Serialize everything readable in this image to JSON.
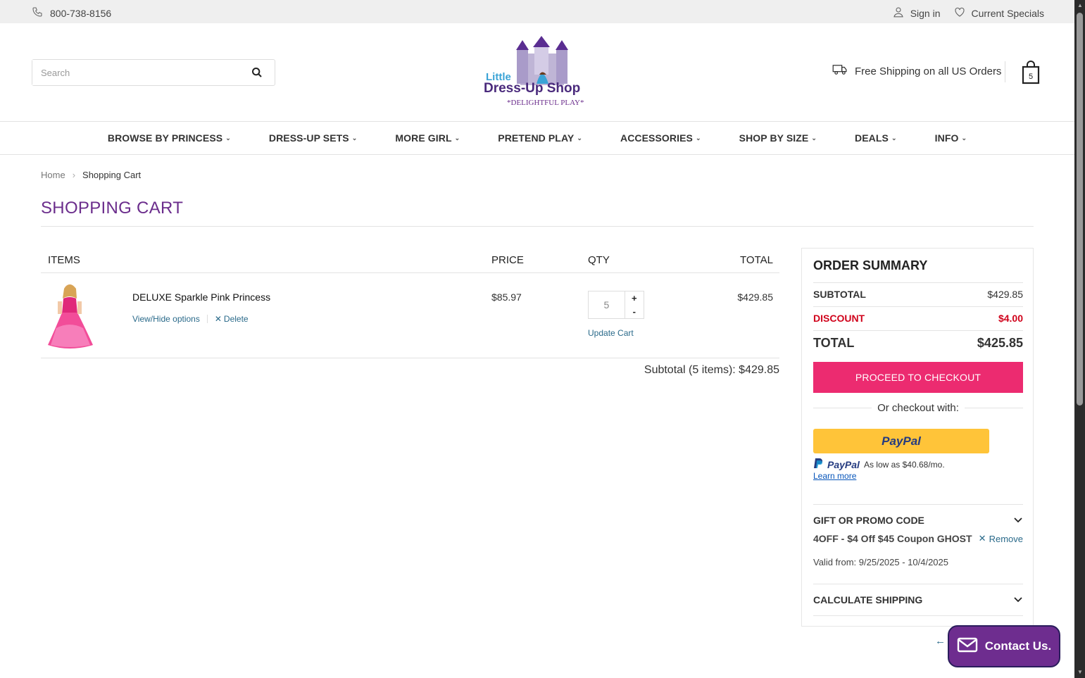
{
  "topbar": {
    "phone": "800-738-8156",
    "sign_in": "Sign in",
    "specials": "Current Specials"
  },
  "header": {
    "search_placeholder": "Search",
    "logo": {
      "line1": "Little",
      "line2": "Dress-Up Shop",
      "tagline": "*DELIGHTFUL PLAY*"
    },
    "shipping": "Free Shipping on all US Orders",
    "cart_count": "5"
  },
  "nav": [
    {
      "label": "BROWSE BY PRINCESS"
    },
    {
      "label": "DRESS-UP SETS"
    },
    {
      "label": "MORE GIRL"
    },
    {
      "label": "PRETEND PLAY"
    },
    {
      "label": "ACCESSORIES"
    },
    {
      "label": "SHOP BY SIZE"
    },
    {
      "label": "DEALS"
    },
    {
      "label": "INFO"
    }
  ],
  "breadcrumb": {
    "home": "Home",
    "current": "Shopping Cart"
  },
  "page_title": "SHOPPING CART",
  "cart": {
    "headers": {
      "items": "ITEMS",
      "price": "PRICE",
      "qty": "QTY",
      "total": "TOTAL"
    },
    "item": {
      "name": "DELUXE Sparkle Pink Princess",
      "options_link": "View/Hide options",
      "delete": "Delete",
      "price": "$85.97",
      "qty": "5",
      "update": "Update Cart",
      "total": "$429.85"
    },
    "subtotal_line": "Subtotal (5 items): $429.85"
  },
  "summary": {
    "title": "ORDER SUMMARY",
    "subtotal_label": "SUBTOTAL",
    "subtotal": "$429.85",
    "discount_label": "DISCOUNT",
    "discount": "$4.00",
    "total_label": "TOTAL",
    "total": "$425.85",
    "checkout": "PROCEED TO CHECKOUT",
    "or_with": "Or checkout with:",
    "paypal_brand": "PayPal",
    "paylater_text": "As low as $40.68/mo.",
    "learn_more": "Learn more",
    "promo_header": "GIFT OR PROMO CODE",
    "promo_code": "4OFF - $4 Off $45 Coupon GHOST",
    "remove": "Remove",
    "valid": "Valid from: 9/25/2025 - 10/4/2025",
    "calc_shipping": "CALCULATE SHIPPING"
  },
  "contact": "Contact Us.",
  "colors": {
    "accent": "#6b2d8c",
    "checkout": "#ec2b70",
    "discount": "#d0021b",
    "link": "#2a6a8a",
    "paypal": "#ffc439"
  }
}
